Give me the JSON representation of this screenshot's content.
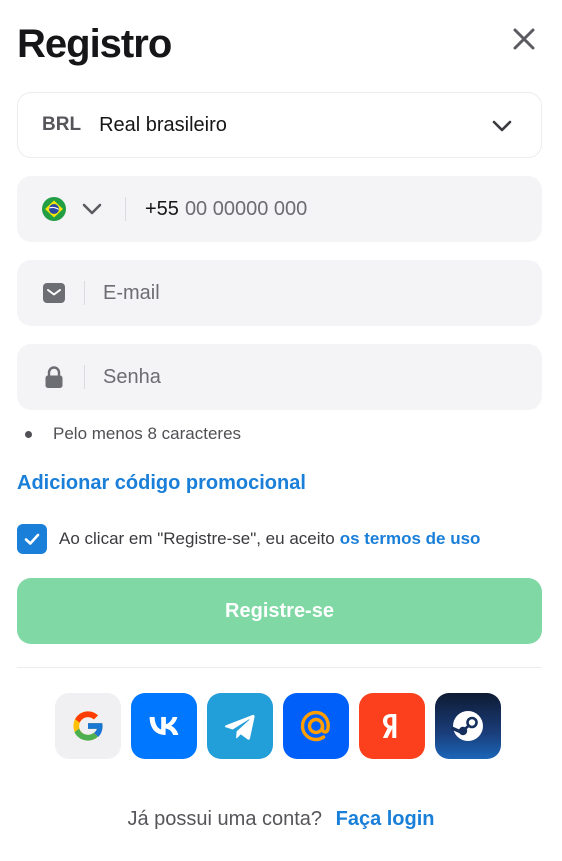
{
  "header": {
    "title": "Registro"
  },
  "currency": {
    "code": "BRL",
    "name": "Real brasileiro"
  },
  "phone": {
    "country": "Brazil",
    "prefix": "+55",
    "placeholder": "00 00000 000"
  },
  "email": {
    "placeholder": "E-mail"
  },
  "password": {
    "placeholder": "Senha",
    "hint": "Pelo menos 8 caracteres"
  },
  "promo": {
    "label": "Adicionar código promocional"
  },
  "terms": {
    "checked": true,
    "text": "Ao clicar em \"Registre-se\", eu aceito",
    "link": "os termos de uso"
  },
  "submit": {
    "label": "Registre-se"
  },
  "socials": [
    {
      "name": "Google",
      "icon": "google-icon"
    },
    {
      "name": "VK",
      "icon": "vk-icon"
    },
    {
      "name": "Telegram",
      "icon": "telegram-icon"
    },
    {
      "name": "Mail.ru",
      "icon": "mail-ru-icon"
    },
    {
      "name": "Yandex",
      "icon": "yandex-icon"
    },
    {
      "name": "Steam",
      "icon": "steam-icon"
    }
  ],
  "footer": {
    "question": "Já possui uma conta?",
    "login_link": "Faça login"
  },
  "colors": {
    "accent": "#1a7fd8",
    "submit_bg": "#80d9a4",
    "field_bg": "#f4f4f6"
  }
}
